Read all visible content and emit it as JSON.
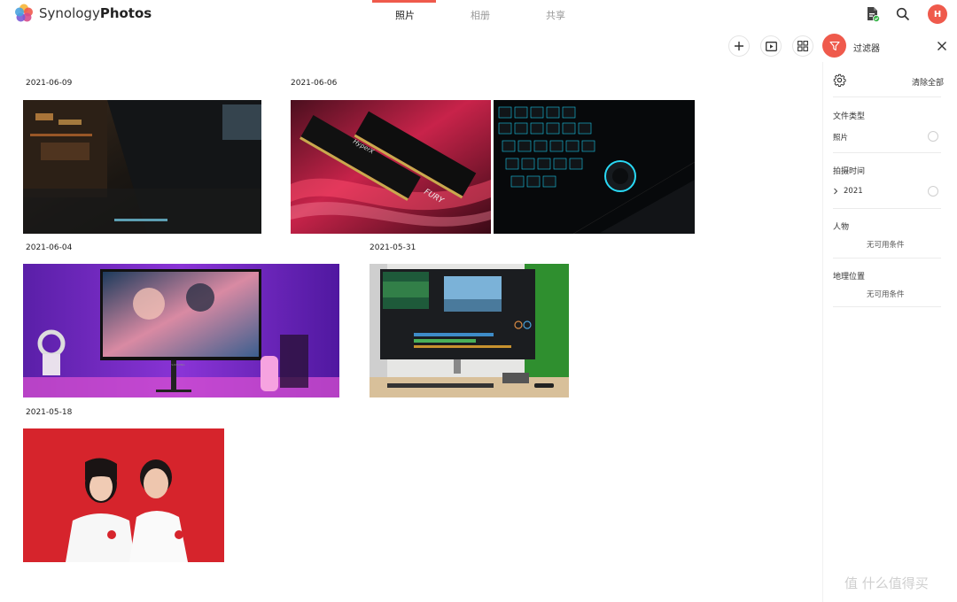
{
  "app": {
    "brand_light": "Synology",
    "brand_bold": "Photos"
  },
  "nav": {
    "tabs": [
      "照片",
      "相册",
      "共享"
    ],
    "active": 0
  },
  "header": {
    "avatar_letter": "H"
  },
  "filter": {
    "title": "过滤器",
    "clear_all": "清除全部",
    "sections": {
      "file_type": {
        "label": "文件类型",
        "option": "照片"
      },
      "time": {
        "label": "拍摄时间",
        "option": "2021"
      },
      "people": {
        "label": "人物",
        "empty": "无可用条件"
      },
      "location": {
        "label": "地理位置",
        "empty": "无可用条件"
      }
    }
  },
  "photos": {
    "groups": [
      {
        "date": "2021-06-09"
      },
      {
        "date": "2021-06-06"
      },
      {
        "date": "2021-06-04"
      },
      {
        "date": "2021-05-31"
      },
      {
        "date": "2021-05-18"
      }
    ],
    "monitor_brand": "SAMSUNG",
    "ram_labels": [
      "HyperX",
      "FURY",
      "FURY"
    ]
  },
  "watermark": "值 什么值得买",
  "colors": {
    "accent": "#ef5a4c",
    "active_text": "#222222",
    "inactive_text": "#999999"
  }
}
